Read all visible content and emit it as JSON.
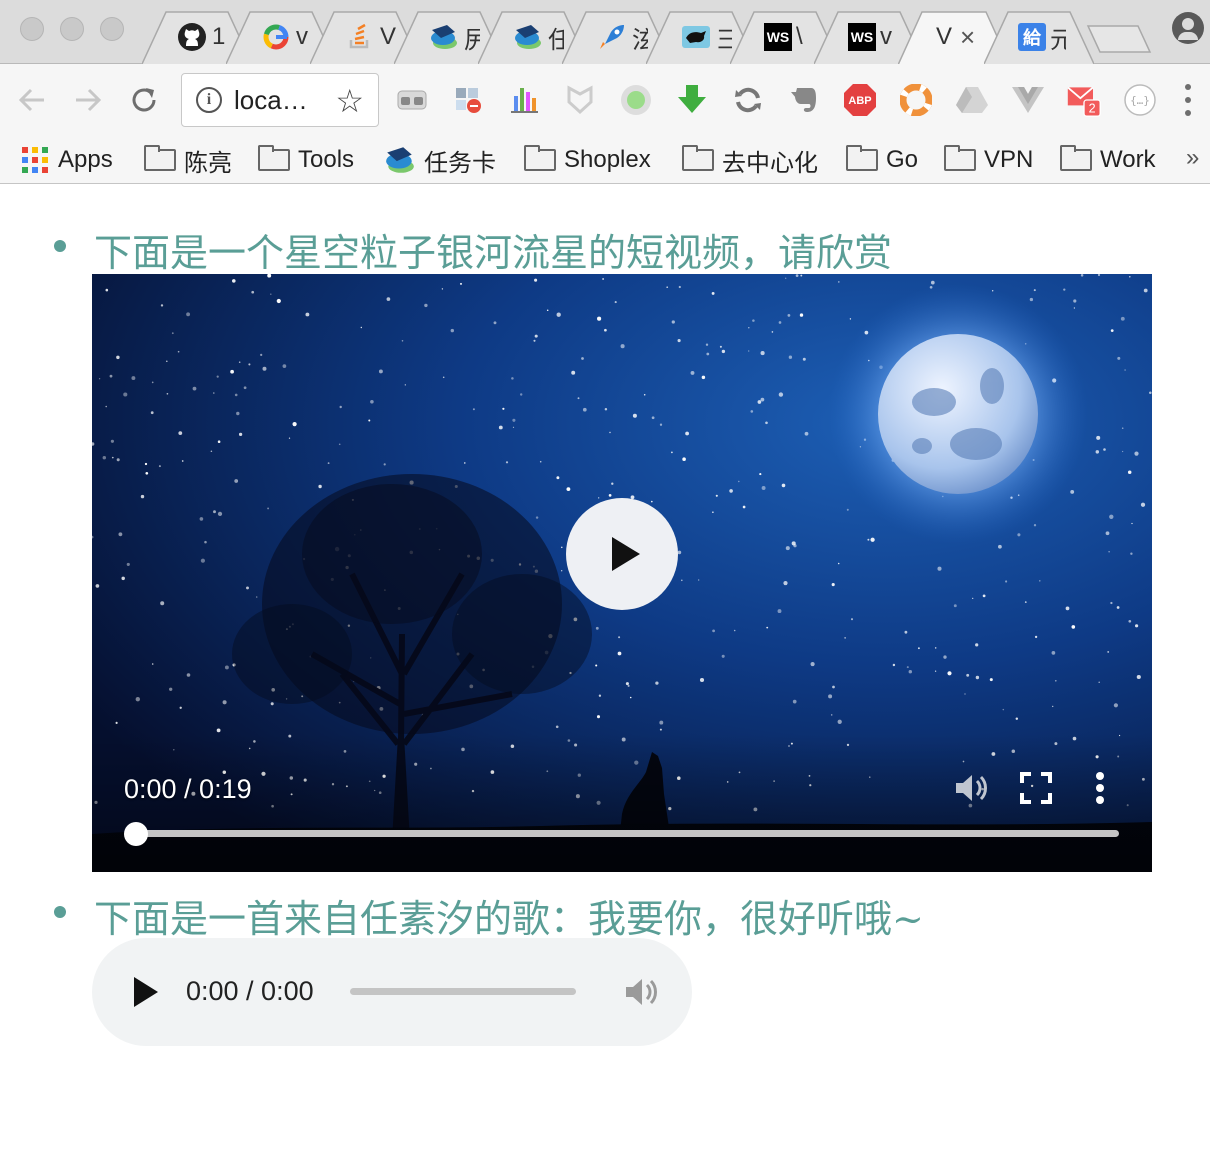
{
  "browser": {
    "tabs": [
      {
        "favicon": "github-icon",
        "text": "1"
      },
      {
        "favicon": "google-icon",
        "text": "v"
      },
      {
        "favicon": "stackoverflow-icon",
        "text": "V"
      },
      {
        "favicon": "task-card-icon",
        "text": "尻"
      },
      {
        "favicon": "task-card-icon",
        "text": "任"
      },
      {
        "favicon": "rocket-icon",
        "text": "泫"
      },
      {
        "favicon": "panther-icon",
        "text": "彐"
      },
      {
        "favicon": "webstorm-icon",
        "text": "\\"
      },
      {
        "favicon": "webstorm-icon",
        "text": "v"
      },
      {
        "favicon": "",
        "text": "V",
        "close": "×",
        "active": true
      },
      {
        "favicon": "translate-icon",
        "text": "元"
      }
    ],
    "active_tab_favicon_letter": "WS",
    "translate_glyph": "給",
    "url": "loca…",
    "extensions": [
      "vr-goggles-icon",
      "color-picker-icon",
      "stats-icon",
      "shield-icon",
      "record-icon",
      "download-arrow-icon",
      "sync-icon",
      "evernote-icon",
      "adblock-icon",
      "lifebuoy-icon",
      "drive-icon",
      "vue-devtools-icon",
      "mail-icon",
      "json-viewer-icon"
    ],
    "abp_label": "ABP",
    "mail_badge": "2",
    "json_label": "{…}",
    "bookmarks": [
      {
        "type": "apps",
        "label": "Apps"
      },
      {
        "type": "folder",
        "label": "陈亮"
      },
      {
        "type": "folder",
        "label": "Tools"
      },
      {
        "type": "task",
        "label": "任务卡"
      },
      {
        "type": "folder",
        "label": "Shoplex"
      },
      {
        "type": "folder",
        "label": "去中心化"
      },
      {
        "type": "folder",
        "label": "Go"
      },
      {
        "type": "folder",
        "label": "VPN"
      },
      {
        "type": "folder",
        "label": "Work"
      }
    ],
    "bookmarks_more": "»"
  },
  "page": {
    "items": [
      {
        "text": "下面是一个星空粒子银河流星的短视频，请欣赏"
      },
      {
        "text": "下面是一首来自任素汐的歌：我要你，很好听哦~"
      }
    ],
    "video": {
      "time": "0:00 / 0:19",
      "progress": 0.0,
      "controls": [
        "volume-icon",
        "fullscreen-icon",
        "more-options-icon"
      ]
    },
    "audio": {
      "time": "0:00 / 0:00",
      "progress": 0.0
    }
  }
}
